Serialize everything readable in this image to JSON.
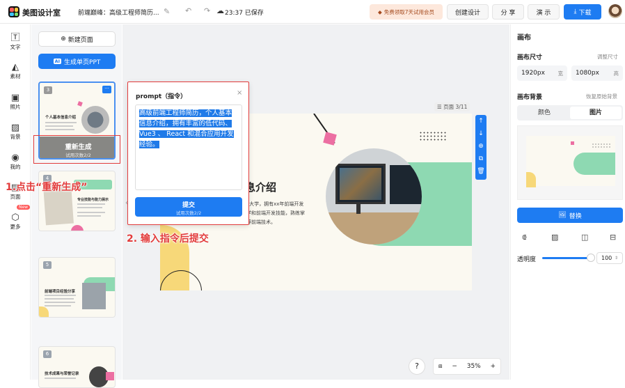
{
  "app": {
    "name": "美图设计室",
    "doc_title": "前端巅峰：高级工程师简历...",
    "save_time": "23:37 已保存"
  },
  "topbar": {
    "vip_label": "免费领取7天试用会员",
    "create_label": "创建设计",
    "share_label": "分 享",
    "present_label": "演 示",
    "download_label": "下载"
  },
  "tools": [
    {
      "label": "文字",
      "icon": "text-icon"
    },
    {
      "label": "素材",
      "icon": "shapes-icon"
    },
    {
      "label": "照片",
      "icon": "image-icon"
    },
    {
      "label": "背景",
      "icon": "background-icon"
    },
    {
      "label": "我的",
      "icon": "user-icon"
    },
    {
      "label": "页面",
      "icon": "pages-icon"
    },
    {
      "label": "更多",
      "icon": "more-icon"
    }
  ],
  "more_badge": "New",
  "pages_panel": {
    "new_page_label": "新建页面",
    "generate_label": "生成单页PPT",
    "ai_badge": "AI",
    "regenerate_label": "重新生成",
    "regenerate_count": "试用次数2/2",
    "thumbs": [
      {
        "num": "3",
        "title": "个人基本信息介绍"
      },
      {
        "num": "4",
        "title": "专业技能与能力展示"
      },
      {
        "num": "5",
        "title": "前端项目经验分享"
      },
      {
        "num": "6",
        "title": "技术成果与荣誉记录"
      }
    ]
  },
  "prompt": {
    "title": "prompt（指令）",
    "close": "×",
    "text": "高级前端工程师简历，个人基本信息介绍，拥有丰富的低代码、Vue3 、 React 和混合应用开发经验。",
    "submit_label": "提交",
    "submit_count": "试用次数2/2"
  },
  "annotations": {
    "step1": "1.点击“重新生成”",
    "step2": "2. 输入指令后提交"
  },
  "canvas": {
    "page_indicator": "页面 3/11",
    "slide_heading": "息介绍",
    "slide_body": [
      "x大学，拥有xx年前端开发",
      "学和前端开发技能，熟练掌",
      "等前端技术。"
    ],
    "zoom": "35%",
    "help": "?"
  },
  "right_panel": {
    "title": "画布",
    "size_label": "画布尺寸",
    "size_action": "调整尺寸",
    "width_value": "1920px",
    "width_unit": "宽",
    "height_value": "1080px",
    "height_unit": "高",
    "bg_label": "画布背景",
    "bg_action": "恢复原始背景",
    "tab_color": "颜色",
    "tab_image": "图片",
    "replace_label": "替换",
    "opacity_label": "透明度",
    "opacity_value": "100"
  },
  "colors": {
    "accent": "#1e7cf2",
    "annotation": "#e23b3b",
    "mint": "#8ed9b2",
    "pink": "#ec6fa2",
    "yellow": "#f7d879"
  }
}
